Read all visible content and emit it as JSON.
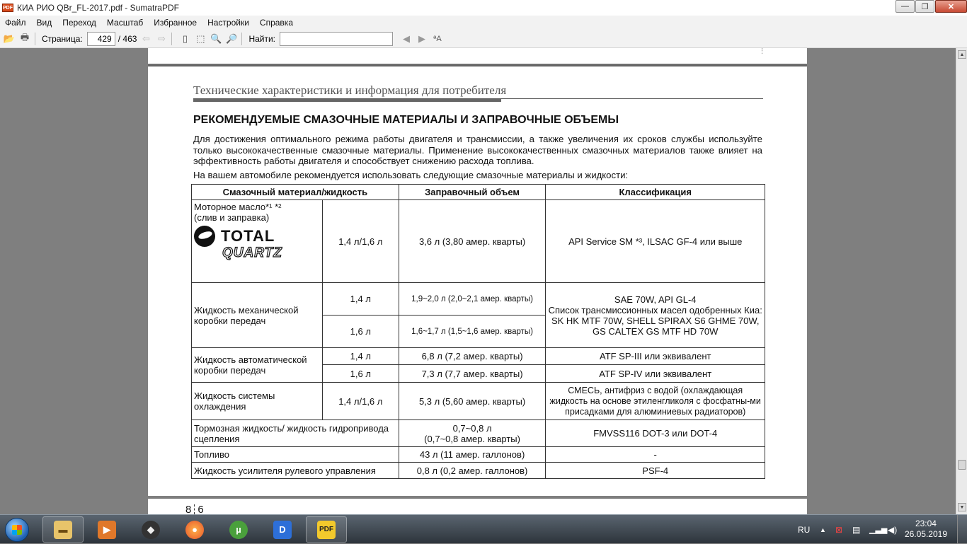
{
  "window": {
    "title": "КИА РИО QBr_FL-2017.pdf - SumatraPDF",
    "app_badge": "PDF"
  },
  "menu": [
    "Файл",
    "Вид",
    "Переход",
    "Масштаб",
    "Избранное",
    "Настройки",
    "Справка"
  ],
  "toolbar": {
    "page_label": "Страница:",
    "page_value": "429",
    "page_total": "/ 463",
    "find_label": "Найти:",
    "find_value": ""
  },
  "document": {
    "running_header": "Технические характеристики и информация для потребителя",
    "heading": "РЕКОМЕНДУЕМЫЕ СМАЗОЧНЫЕ МАТЕРИАЛЫ И ЗАПРАВОЧНЫЕ ОБЪЕМЫ",
    "para1": "Для достижения оптимального режима работы двигателя и трансмиссии, а также увеличения их сроков службы используйте только высококачественные смазочные материалы. Применение высококачественных смазочных материалов также влияет на эффективность работы двигателя и способствует снижению расхода топлива.",
    "para2": "На вашем автомобиле рекомендуется использовать следующие смазочные материалы и жидкости:",
    "table": {
      "headers": [
        "Смазочный материал/жидкость",
        "Заправочный объем",
        "Классификация"
      ],
      "oil_name": "Моторное масло*¹ *²",
      "oil_sub": "(слив и заправка)",
      "oil_engine": "1,4 л/1,6 л",
      "oil_volume": "3,6 л (3,80 амер. кварты)",
      "oil_class": "API Service SM *³, ILSAC GF-4 или выше",
      "logo_total": "TOTAL",
      "logo_quartz": "QUARTZ",
      "mt_name": "Жидкость механической коробки передач",
      "mt_e1": "1,4 л",
      "mt_v1": "1,9~2,0 л (2,0~2,1 амер. кварты)",
      "mt_e2": "1,6 л",
      "mt_v2": "1,6~1,7 л (1,5~1,6 амер. кварты)",
      "mt_class1": "SAE 70W, API GL-4",
      "mt_class2": "Список трансмиссионных масел одобренных Киа:",
      "mt_class3": "SK HK MTF 70W, SHELL SPIRAX S6 GHME 70W, GS CALTEX GS MTF HD 70W",
      "at_name": "Жидкость автоматической коробки передач",
      "at_e1": "1,4 л",
      "at_v1": "6,8 л (7,2 амер. кварты)",
      "at_c1": "ATF SP-III или эквивалент",
      "at_e2": "1,6 л",
      "at_v2": "7,3 л (7,7 амер. кварты)",
      "at_c2": "ATF SP-IV или эквивалент",
      "cool_name": "Жидкость системы охлаждения",
      "cool_engine": "1,4 л/1,6 л",
      "cool_volume": "5,3 л (5,60 амер. кварты)",
      "cool_class": "СМЕСЬ, антифриз с водой (охлаждающая жидкость на основе этиленгликоля с фосфатны-ми присадками для алюминиевых радиаторов)",
      "brake_name": "Тормозная жидкость/ жидкость гидропривода сцепления",
      "brake_volume1": "0,7~0,8 л",
      "brake_volume2": "(0,7~0,8 амер. кварты)",
      "brake_class": "FMVSS116 DOT-3 или  DOT-4",
      "fuel_name": "Топливо",
      "fuel_volume": "43 л  (11 амер. галлонов)",
      "fuel_class": "-",
      "ps_name": "Жидкость усилителя рулевого управления",
      "ps_volume": "0,8 л  (0,2 амер. галлонов)",
      "ps_class": "PSF-4"
    },
    "next_page_number_a": "8",
    "next_page_number_b": "6"
  },
  "taskbar": {
    "apps": [
      "explorer",
      "media-player",
      "nitro",
      "firefox",
      "utorrent",
      "daum",
      "sumatrapdf"
    ],
    "lang": "RU",
    "time": "23:04",
    "date": "26.05.2019"
  }
}
